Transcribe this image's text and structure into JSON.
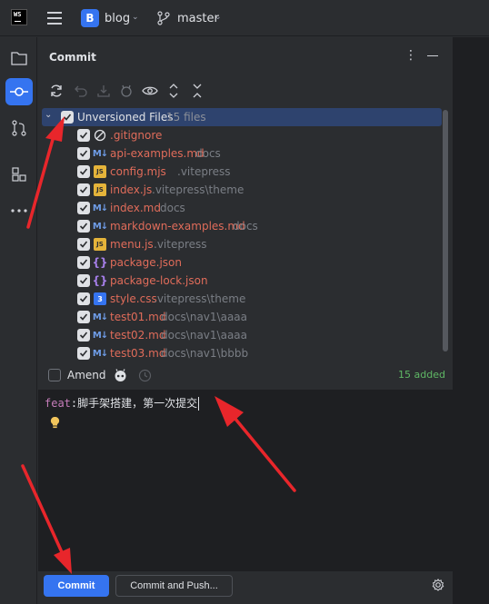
{
  "topbar": {
    "logo_text": "WS",
    "project_initial": "B",
    "project_name": "blog",
    "branch_name": "master"
  },
  "panel": {
    "title": "Commit"
  },
  "changes": {
    "group_label": "Unversioned Files",
    "group_count": "15 files",
    "files": [
      {
        "name": ".gitignore",
        "dir": "",
        "type": "ignore"
      },
      {
        "name": "api-examples.md",
        "dir": "docs",
        "type": "md"
      },
      {
        "name": "config.mjs",
        "dir": ".vitepress",
        "type": "js"
      },
      {
        "name": "index.js",
        "dir": ".vitepress\\theme",
        "type": "js"
      },
      {
        "name": "index.md",
        "dir": "docs",
        "type": "md"
      },
      {
        "name": "markdown-examples.md",
        "dir": "docs",
        "type": "md"
      },
      {
        "name": "menu.js",
        "dir": ".vitepress",
        "type": "js"
      },
      {
        "name": "package.json",
        "dir": "",
        "type": "json"
      },
      {
        "name": "package-lock.json",
        "dir": "",
        "type": "json"
      },
      {
        "name": "style.css",
        "dir": ".vitepress\\theme",
        "type": "css"
      },
      {
        "name": "test01.md",
        "dir": "docs\\nav1\\aaaa",
        "type": "md"
      },
      {
        "name": "test02.md",
        "dir": "docs\\nav1\\aaaa",
        "type": "md"
      },
      {
        "name": "test03.md",
        "dir": "docs\\nav1\\bbbb",
        "type": "md"
      }
    ]
  },
  "amend": {
    "label": "Amend",
    "added_status": "15 added"
  },
  "message": {
    "prefix": "feat",
    "text": ":脚手架搭建，第一次提交"
  },
  "buttons": {
    "commit": "Commit",
    "commit_and_push": "Commit and Push..."
  },
  "colors": {
    "accent": "#3574f0",
    "unversioned_file": "#e06c5a",
    "added_status": "#5fb865",
    "annotation_arrow": "#e8262b"
  }
}
